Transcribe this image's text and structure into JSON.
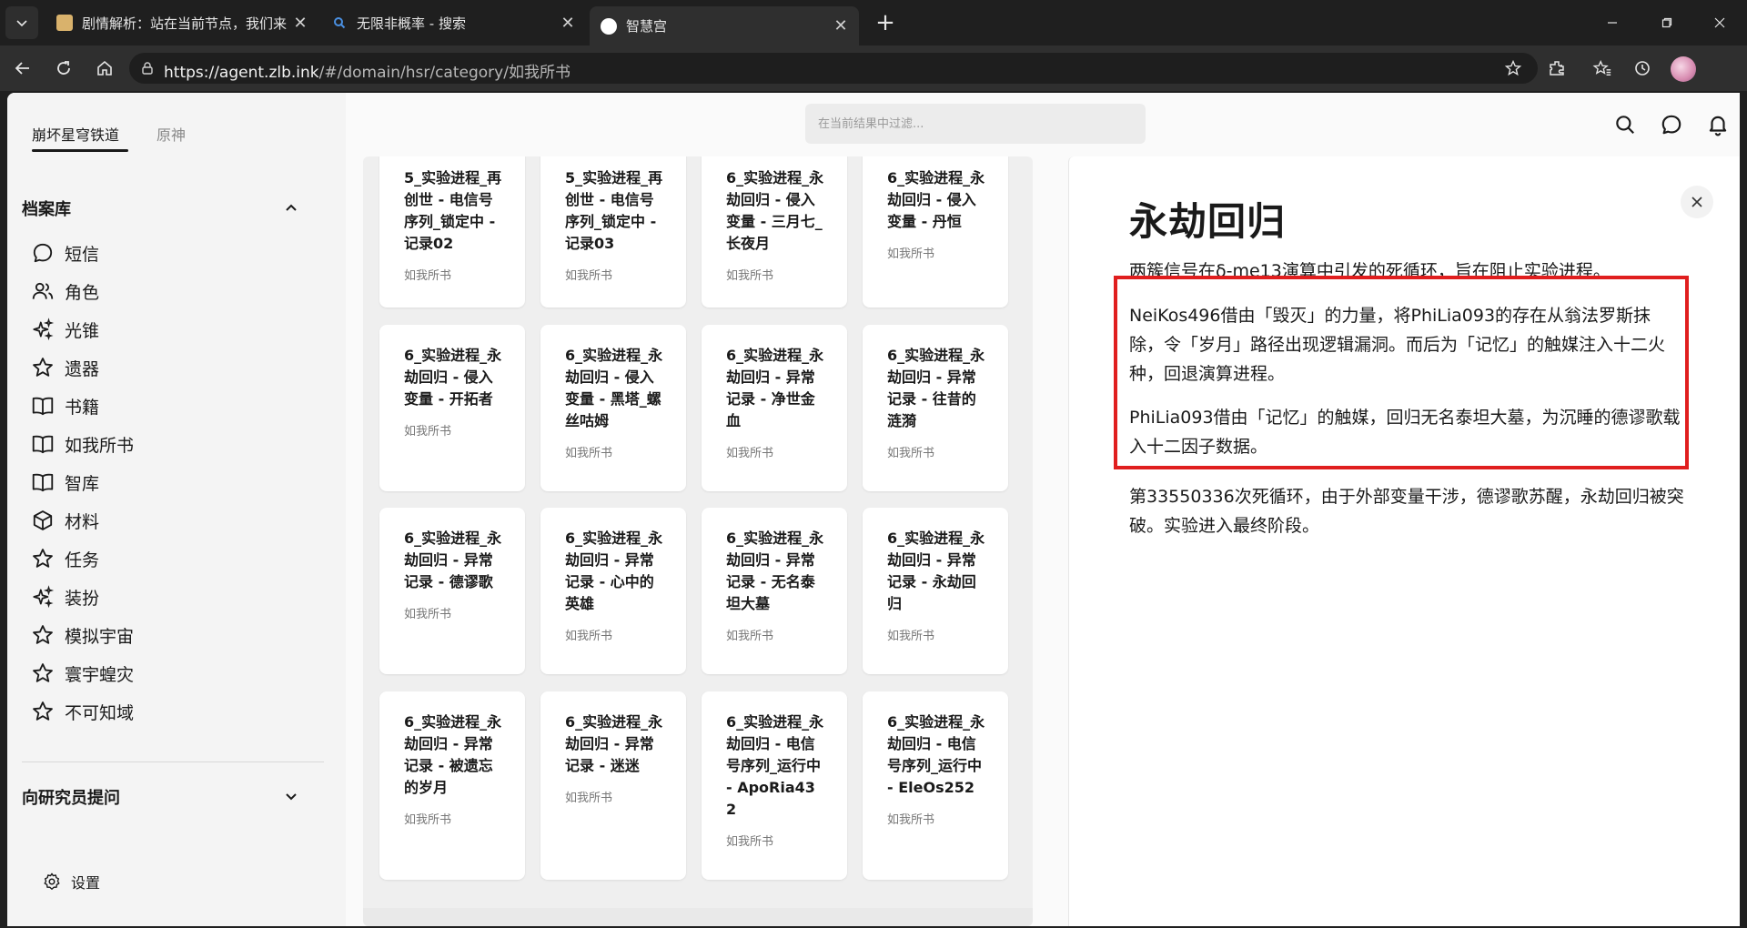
{
  "browser": {
    "tabs": [
      {
        "title": "剧情解析：站在当前节点，我们来",
        "active": false
      },
      {
        "title": "无限非概率 - 搜索",
        "active": false
      },
      {
        "title": "智慧宫",
        "active": true
      }
    ],
    "new_tab": "+",
    "url_host": "https://agent.zlb.ink",
    "url_path": "/#/domain/hsr/category/如我所书"
  },
  "sidebar": {
    "game_tabs": [
      "崩坏星穹铁道",
      "原神"
    ],
    "archive_heading": "档案库",
    "items": [
      {
        "label": "短信",
        "icon": "chat-bubble-icon"
      },
      {
        "label": "角色",
        "icon": "users-icon"
      },
      {
        "label": "光锥",
        "icon": "sparkles-icon"
      },
      {
        "label": "遗器",
        "icon": "star-icon"
      },
      {
        "label": "书籍",
        "icon": "book-icon"
      },
      {
        "label": "如我所书",
        "icon": "book-icon"
      },
      {
        "label": "智库",
        "icon": "book-icon"
      },
      {
        "label": "材料",
        "icon": "cube-icon"
      },
      {
        "label": "任务",
        "icon": "star-icon"
      },
      {
        "label": "装扮",
        "icon": "sparkles-icon"
      },
      {
        "label": "模拟宇宙",
        "icon": "star-icon"
      },
      {
        "label": "寰宇蝗灾",
        "icon": "star-icon"
      },
      {
        "label": "不可知域",
        "icon": "star-icon"
      }
    ],
    "ask_heading": "向研究员提问",
    "settings_label": "设置"
  },
  "topbar": {
    "filter_placeholder": "在当前结果中过滤..."
  },
  "cards": [
    {
      "title": "5_实验进程_再创世 - 电信号序列_锁定中 - 记录02",
      "sub": "如我所书"
    },
    {
      "title": "5_实验进程_再创世 - 电信号序列_锁定中 - 记录03",
      "sub": "如我所书"
    },
    {
      "title": "6_实验进程_永劫回归 - 侵入变量 - 三月七_长夜月",
      "sub": "如我所书"
    },
    {
      "title": "6_实验进程_永劫回归 - 侵入变量 - 丹恒",
      "sub": "如我所书"
    },
    {
      "title": "6_实验进程_永劫回归 - 侵入变量 - 开拓者",
      "sub": "如我所书"
    },
    {
      "title": "6_实验进程_永劫回归 - 侵入变量 - 黑塔_螺丝咕姆",
      "sub": "如我所书"
    },
    {
      "title": "6_实验进程_永劫回归 - 异常记录 - 净世金血",
      "sub": "如我所书"
    },
    {
      "title": "6_实验进程_永劫回归 - 异常记录 - 往昔的涟漪",
      "sub": "如我所书"
    },
    {
      "title": "6_实验进程_永劫回归 - 异常记录 - 德谬歌",
      "sub": "如我所书"
    },
    {
      "title": "6_实验进程_永劫回归 - 异常记录 - 心中的英雄",
      "sub": "如我所书"
    },
    {
      "title": "6_实验进程_永劫回归 - 异常记录 - 无名泰坦大墓",
      "sub": "如我所书"
    },
    {
      "title": "6_实验进程_永劫回归 - 异常记录 - 永劫回归",
      "sub": "如我所书"
    },
    {
      "title": "6_实验进程_永劫回归 - 异常记录 - 被遗忘的岁月",
      "sub": "如我所书"
    },
    {
      "title": "6_实验进程_永劫回归 - 异常记录 - 迷迷",
      "sub": "如我所书"
    },
    {
      "title": "6_实验进程_永劫回归 - 电信号序列_运行中 - ApoRia432",
      "sub": "如我所书"
    },
    {
      "title": "6_实验进程_永劫回归 - 电信号序列_运行中 - EleOs252",
      "sub": "如我所书"
    }
  ],
  "detail": {
    "title": "永劫回归",
    "paragraphs": [
      "两簇信号在δ-me13演算中引发的死循环，旨在阻止实验进程。",
      "NeiKos496借由「毁灭」的力量，将PhiLia093的存在从翁法罗斯抹除，令「岁月」路径出现逻辑漏洞。而后为「记忆」的触媒注入十二火种，回退演算进程。",
      "PhiLia093借由「记忆」的触媒，回归无名泰坦大墓，为沉睡的德谬歌载入十二因子数据。",
      "第33550336次死循环，由于外部变量干涉，德谬歌苏醒，永劫回归被突破。实验进入最终阶段。"
    ]
  },
  "colors": {
    "highlight": "#e01e1e"
  }
}
